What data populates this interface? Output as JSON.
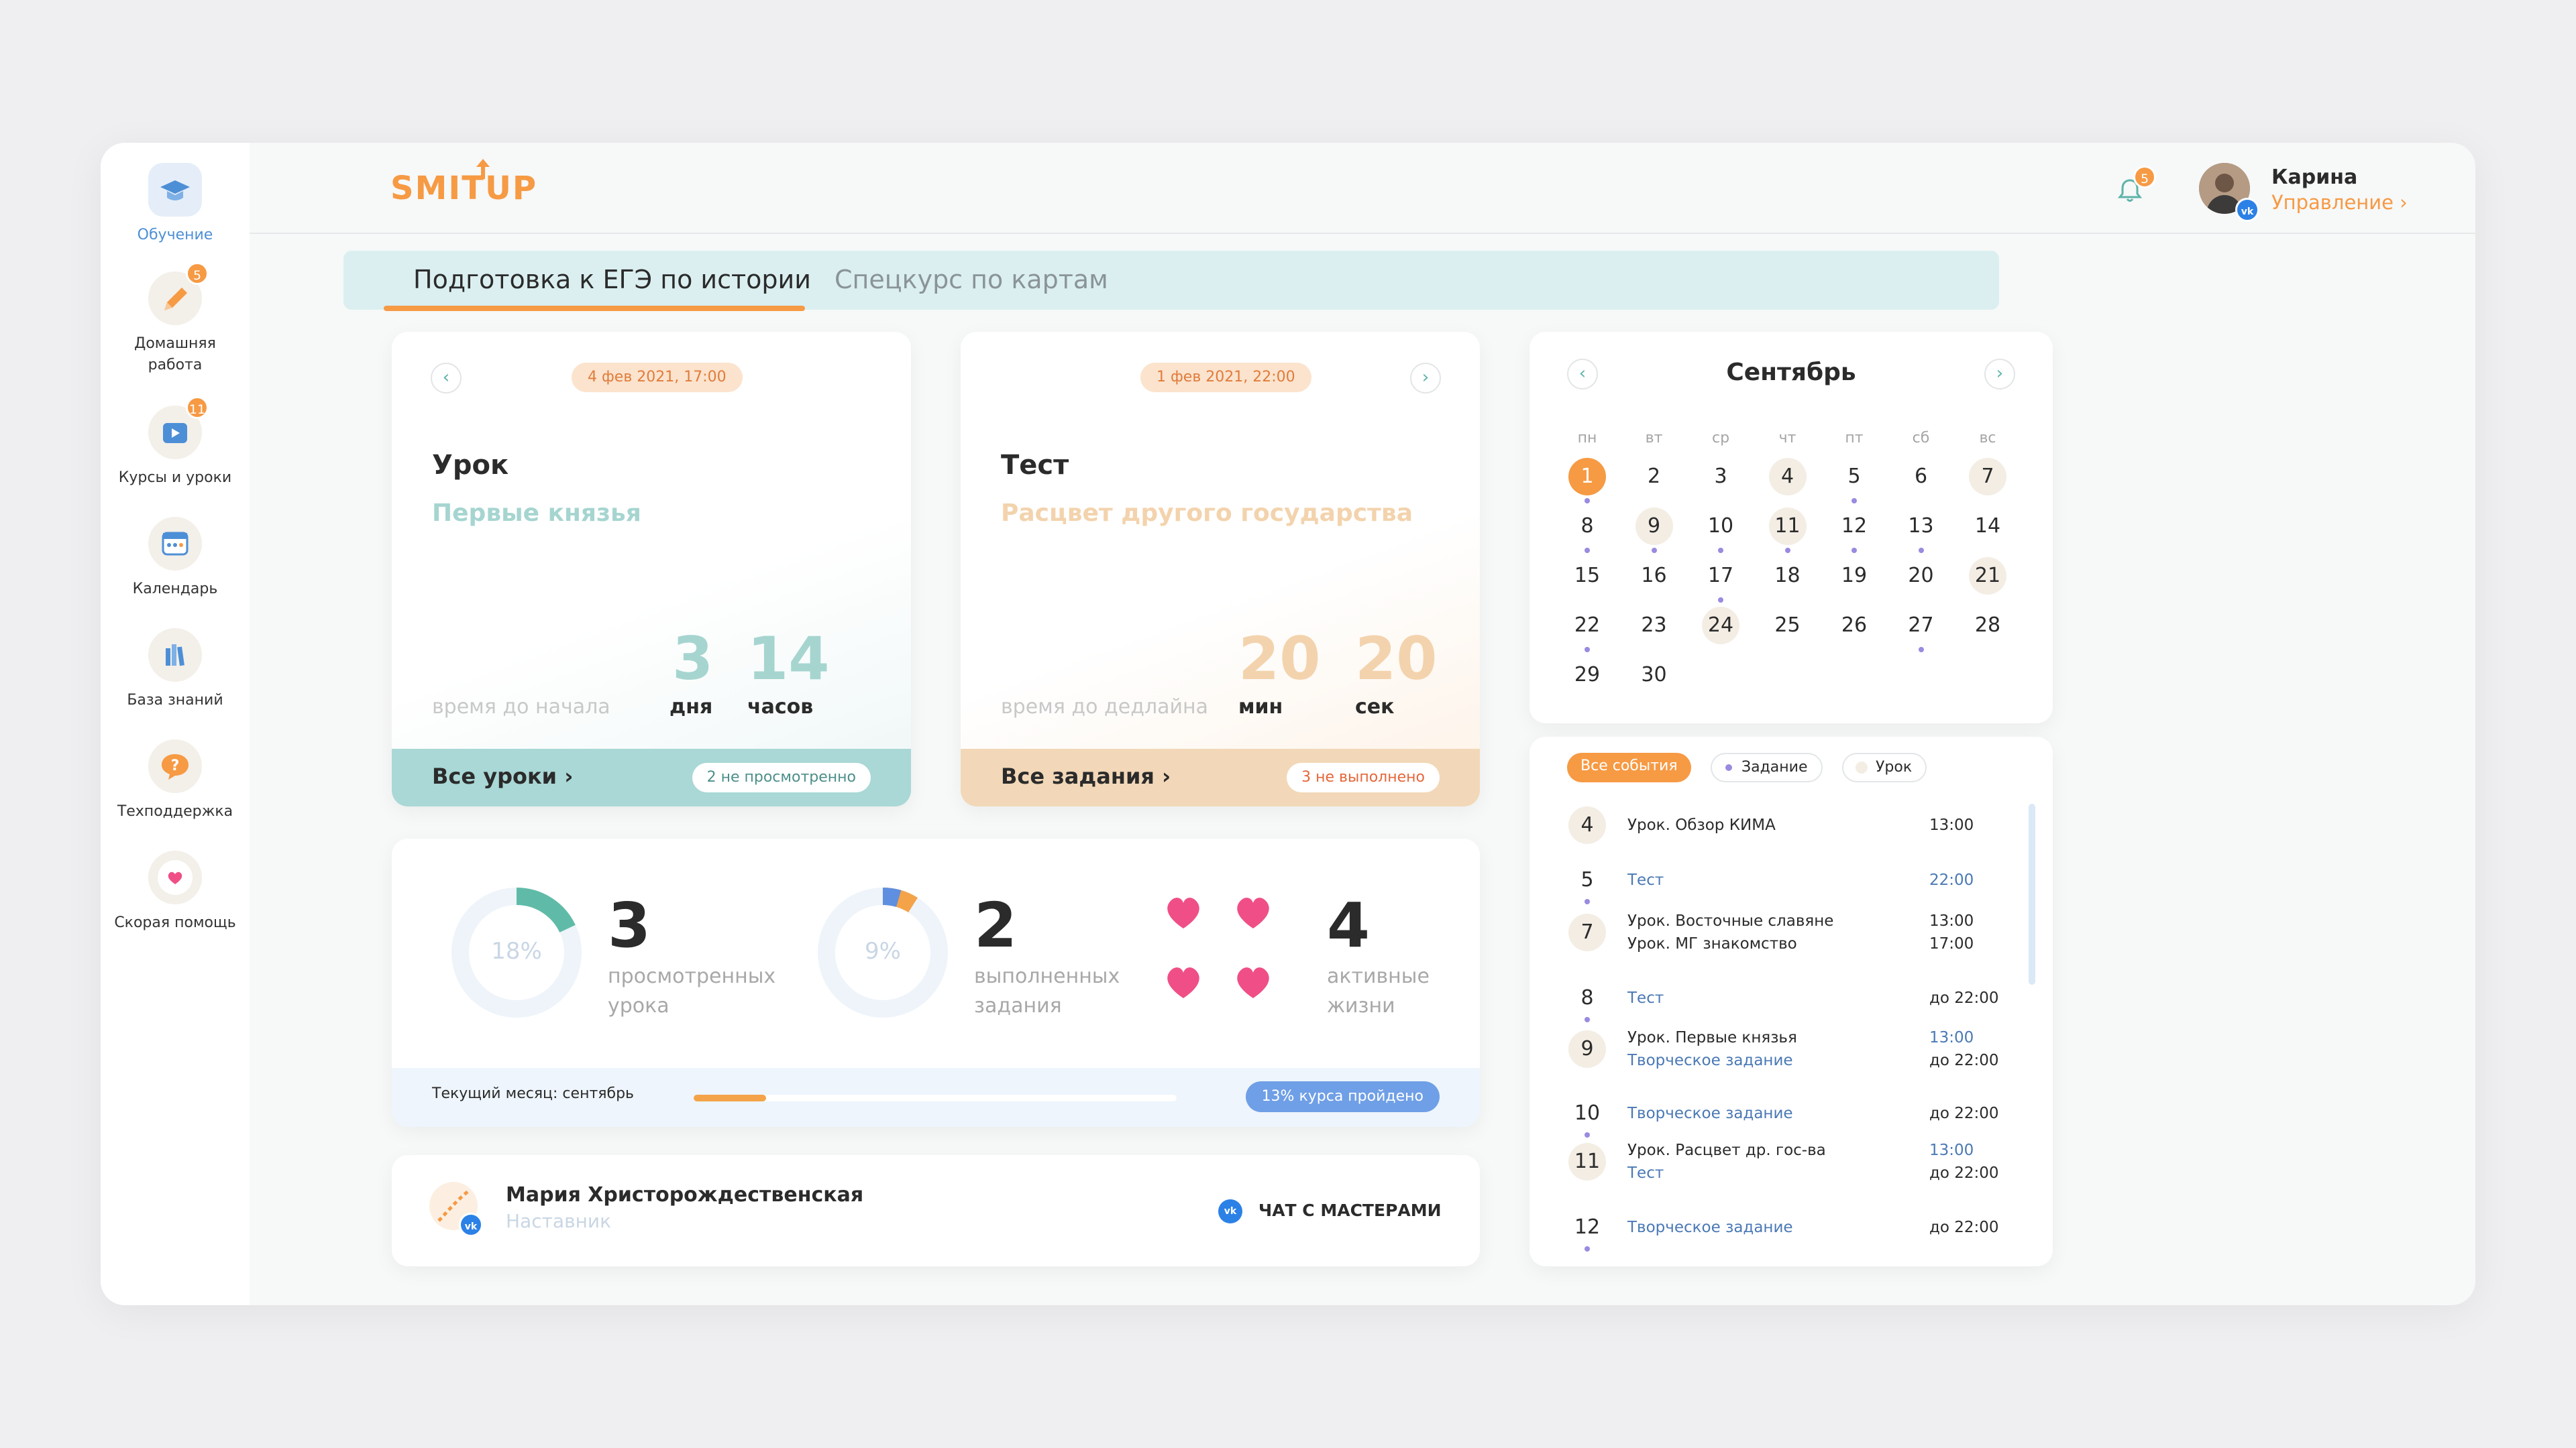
{
  "sidebar": {
    "items": [
      {
        "label": "Обучение",
        "icon": "graduation-cap-icon",
        "active": true
      },
      {
        "label": "Домашняя работа",
        "icon": "pencil-icon",
        "badge": "5"
      },
      {
        "label": "Курсы и уроки",
        "icon": "video-lesson-icon",
        "badge": "11"
      },
      {
        "label": "Календарь",
        "icon": "calendar-icon"
      },
      {
        "label": "База знаний",
        "icon": "books-icon"
      },
      {
        "label": "Техподдержка",
        "icon": "question-icon"
      },
      {
        "label": "Скорая помощь",
        "icon": "heart-icon"
      }
    ]
  },
  "header": {
    "logo": "SMITUP",
    "notifications": "5",
    "user_name": "Карина",
    "user_link": "Управление"
  },
  "tabs": [
    {
      "label": "Подготовка к ЕГЭ по истории",
      "active": true
    },
    {
      "label": "Спецкурс по картам",
      "active": false
    }
  ],
  "lesson_card": {
    "date": "4 фев 2021, 17:00",
    "title": "Урок",
    "subtitle": "Первые князья",
    "countdown_label": "время до начала",
    "value1": "3",
    "unit1": "дня",
    "value2": "14",
    "unit2": "часов",
    "footer_link": "Все уроки",
    "footer_badge": "2 не просмотренно"
  },
  "test_card": {
    "date": "1 фев 2021, 22:00",
    "title": "Тест",
    "subtitle": "Расцвет другого государства",
    "countdown_label": "время до дедлайна",
    "value1": "20",
    "unit1": "мин",
    "value2": "20",
    "unit2": "сек",
    "footer_link": "Все задания",
    "footer_badge": "3 не выполнено"
  },
  "stats": {
    "viewed": {
      "percent": "18%",
      "fraction": 0.18,
      "count": "3",
      "label1": "просмотренных",
      "label2": "урока"
    },
    "done": {
      "percent": "9%",
      "fraction": 0.09,
      "count": "2",
      "label1": "выполненных",
      "label2": "задания"
    },
    "lives": {
      "count": "4",
      "label1": "активные",
      "label2": "жизни"
    },
    "month_label": "Текущий месяц: сентябрь",
    "progress": 0.15,
    "course_badge": "13% курса пройдено"
  },
  "mentor": {
    "name": "Мария Христорождественская",
    "role": "Наставник",
    "chat_label": "ЧАТ С МАСТЕРАМИ"
  },
  "calendar": {
    "month": "Сентябрь",
    "weekdays": [
      "пн",
      "вт",
      "ср",
      "чт",
      "пт",
      "сб",
      "вс"
    ],
    "days": [
      "1",
      "2",
      "3",
      "4",
      "5",
      "6",
      "7",
      "8",
      "9",
      "10",
      "11",
      "12",
      "13",
      "14",
      "15",
      "16",
      "17",
      "18",
      "19",
      "20",
      "21",
      "22",
      "23",
      "24",
      "25",
      "26",
      "27",
      "28",
      "29",
      "30"
    ],
    "today": "1",
    "highlighted": [
      "4",
      "7",
      "9",
      "11",
      "21",
      "24"
    ],
    "dotted": [
      "1",
      "5",
      "8",
      "9",
      "10",
      "11",
      "12",
      "13",
      "17",
      "22",
      "27"
    ]
  },
  "events": {
    "filters": [
      {
        "label": "Все события",
        "active": true
      },
      {
        "label": "Задание",
        "active": false
      },
      {
        "label": "Урок",
        "active": false
      }
    ],
    "items": [
      {
        "day": "4",
        "lines": [
          "Урок. Обзор КИМА"
        ],
        "times": [
          "13:00"
        ],
        "shaded": true
      },
      {
        "day": "5",
        "lines": [
          "Тест"
        ],
        "times": [
          "22:00"
        ],
        "blue": true
      },
      {
        "day": "7",
        "lines": [
          "Урок. Восточные славяне",
          "Урок. МГ знакомство"
        ],
        "times": [
          "13:00",
          "17:00"
        ],
        "shaded": true
      },
      {
        "day": "8",
        "lines": [
          "Тест"
        ],
        "times": [
          "до 22:00"
        ],
        "blue": true
      },
      {
        "day": "9",
        "lines": [
          "Урок. Первые князья",
          "Творческое задание"
        ],
        "times": [
          "13:00",
          "до 22:00"
        ],
        "shaded": true
      },
      {
        "day": "10",
        "lines": [
          "Творческое задание"
        ],
        "times": [
          "до 22:00"
        ],
        "blue": true
      },
      {
        "day": "11",
        "lines": [
          "Урок. Расцвет др. гос-ва",
          "Тест"
        ],
        "times": [
          "13:00",
          "до 22:00"
        ],
        "shaded": true
      },
      {
        "day": "12",
        "lines": [
          "Творческое задание"
        ],
        "times": [
          "до 22:00"
        ],
        "blue": true
      }
    ]
  },
  "colors": {
    "accent": "#f69a44",
    "teal": "#5db3a8",
    "blue": "#4a79b5",
    "heart": "#ef4f86"
  }
}
